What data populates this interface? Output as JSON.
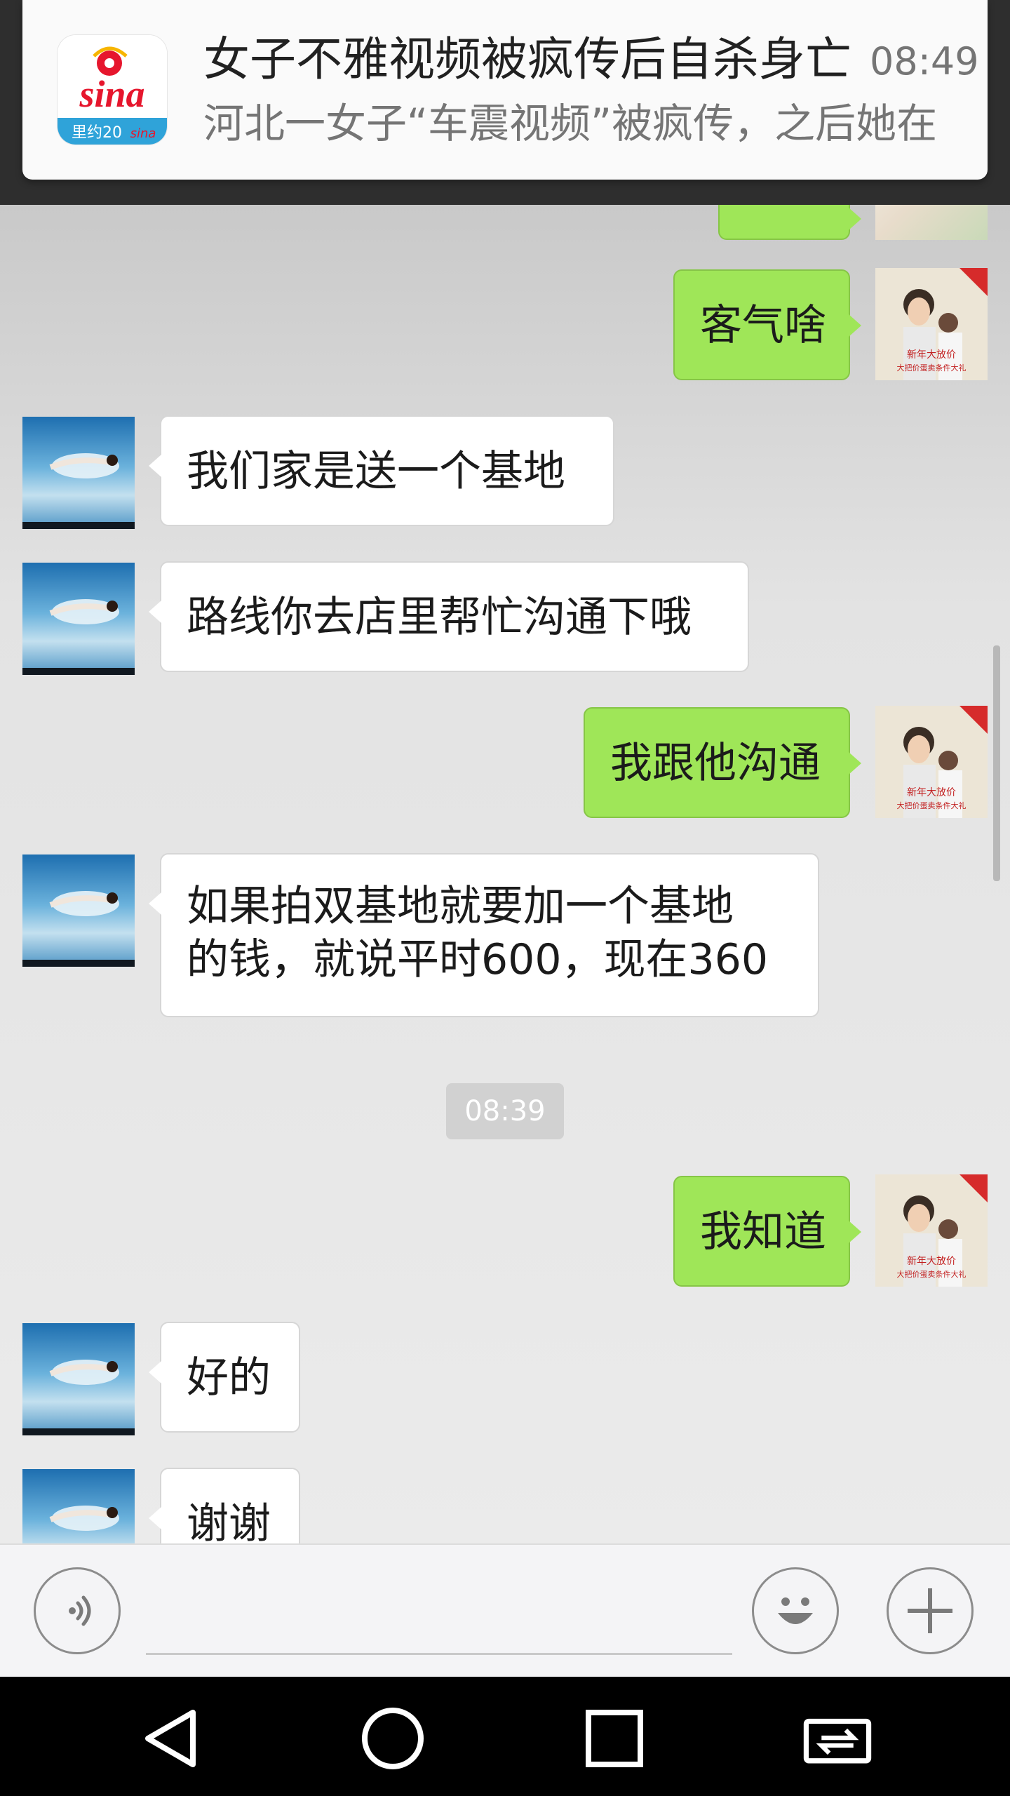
{
  "notification": {
    "title": "女子不雅视频被疯传后自杀身亡",
    "time": "08:49",
    "text": "河北一女子“车震视频”被疯传，之后她在",
    "app_logo_text": "sina",
    "app_logo_subtext": "里约20"
  },
  "messages": [
    {
      "side": "right",
      "text": "客气啥"
    },
    {
      "side": "left",
      "text": "我们家是送一个基地"
    },
    {
      "side": "left",
      "text": "路线你去店里帮忙沟通下哦"
    },
    {
      "side": "right",
      "text": "我跟他沟通"
    },
    {
      "side": "left",
      "lines": [
        "如果拍双基地就要加一个基地",
        "的钱，就说平时600，现在360"
      ]
    },
    {
      "side": "right",
      "text": "我知道"
    },
    {
      "side": "left",
      "text": "好的"
    },
    {
      "side": "left",
      "text": "谢谢"
    }
  ],
  "time_divider": "08:39",
  "avatar_right_caption": [
    "新年大放价",
    "大把价蛋卖条件大礼"
  ],
  "input": {
    "placeholder": ""
  },
  "colors": {
    "bubble_right": "#9fe658",
    "bubble_left": "#ffffff",
    "nav": "#000000"
  },
  "icons": {
    "voice": "voice-icon",
    "emoji": "emoji-icon",
    "plus": "plus-icon",
    "back": "back-icon",
    "home": "home-icon",
    "recent": "recent-apps-icon",
    "switch": "switch-icon"
  }
}
